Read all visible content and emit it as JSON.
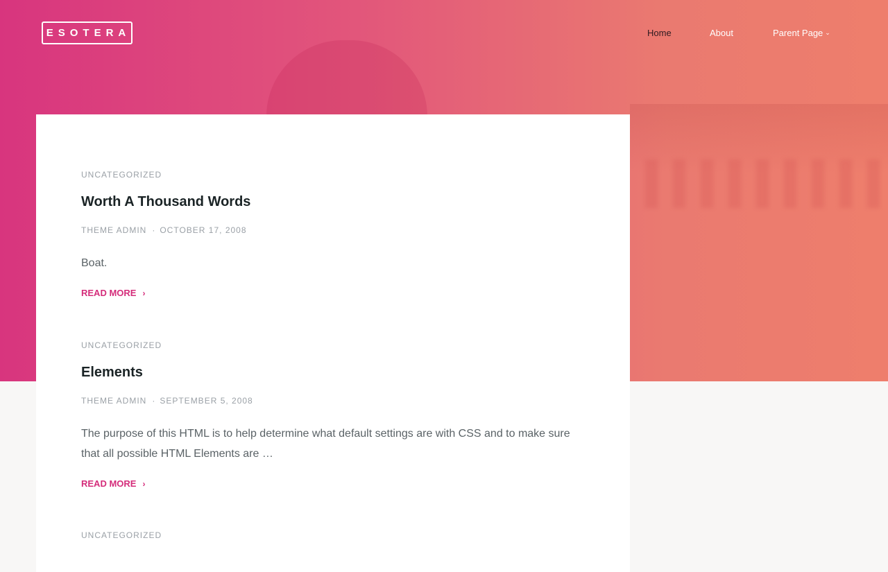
{
  "site": {
    "logo": "ESOTERA"
  },
  "nav": {
    "items": [
      {
        "label": "Home"
      },
      {
        "label": "About"
      },
      {
        "label": "Parent Page"
      }
    ],
    "dropdown_icon": "chevron-down-icon"
  },
  "colors": {
    "accent": "#d42c7a",
    "hero_left": "#d8357e",
    "hero_right": "#ee7e6c"
  },
  "posts": [
    {
      "category": "UNCATEGORIZED",
      "title": "Worth A Thousand Words",
      "author": "THEME ADMIN",
      "date": "OCTOBER 17, 2008",
      "excerpt": "Boat.",
      "read_more": "READ MORE"
    },
    {
      "category": "UNCATEGORIZED",
      "title": "Elements",
      "author": "THEME ADMIN",
      "date": "SEPTEMBER 5, 2008",
      "excerpt": "The purpose of this HTML is to help determine what default settings are with CSS and to make sure that all possible HTML Elements are …",
      "read_more": "READ MORE"
    },
    {
      "category": "UNCATEGORIZED"
    }
  ],
  "separator": "·"
}
